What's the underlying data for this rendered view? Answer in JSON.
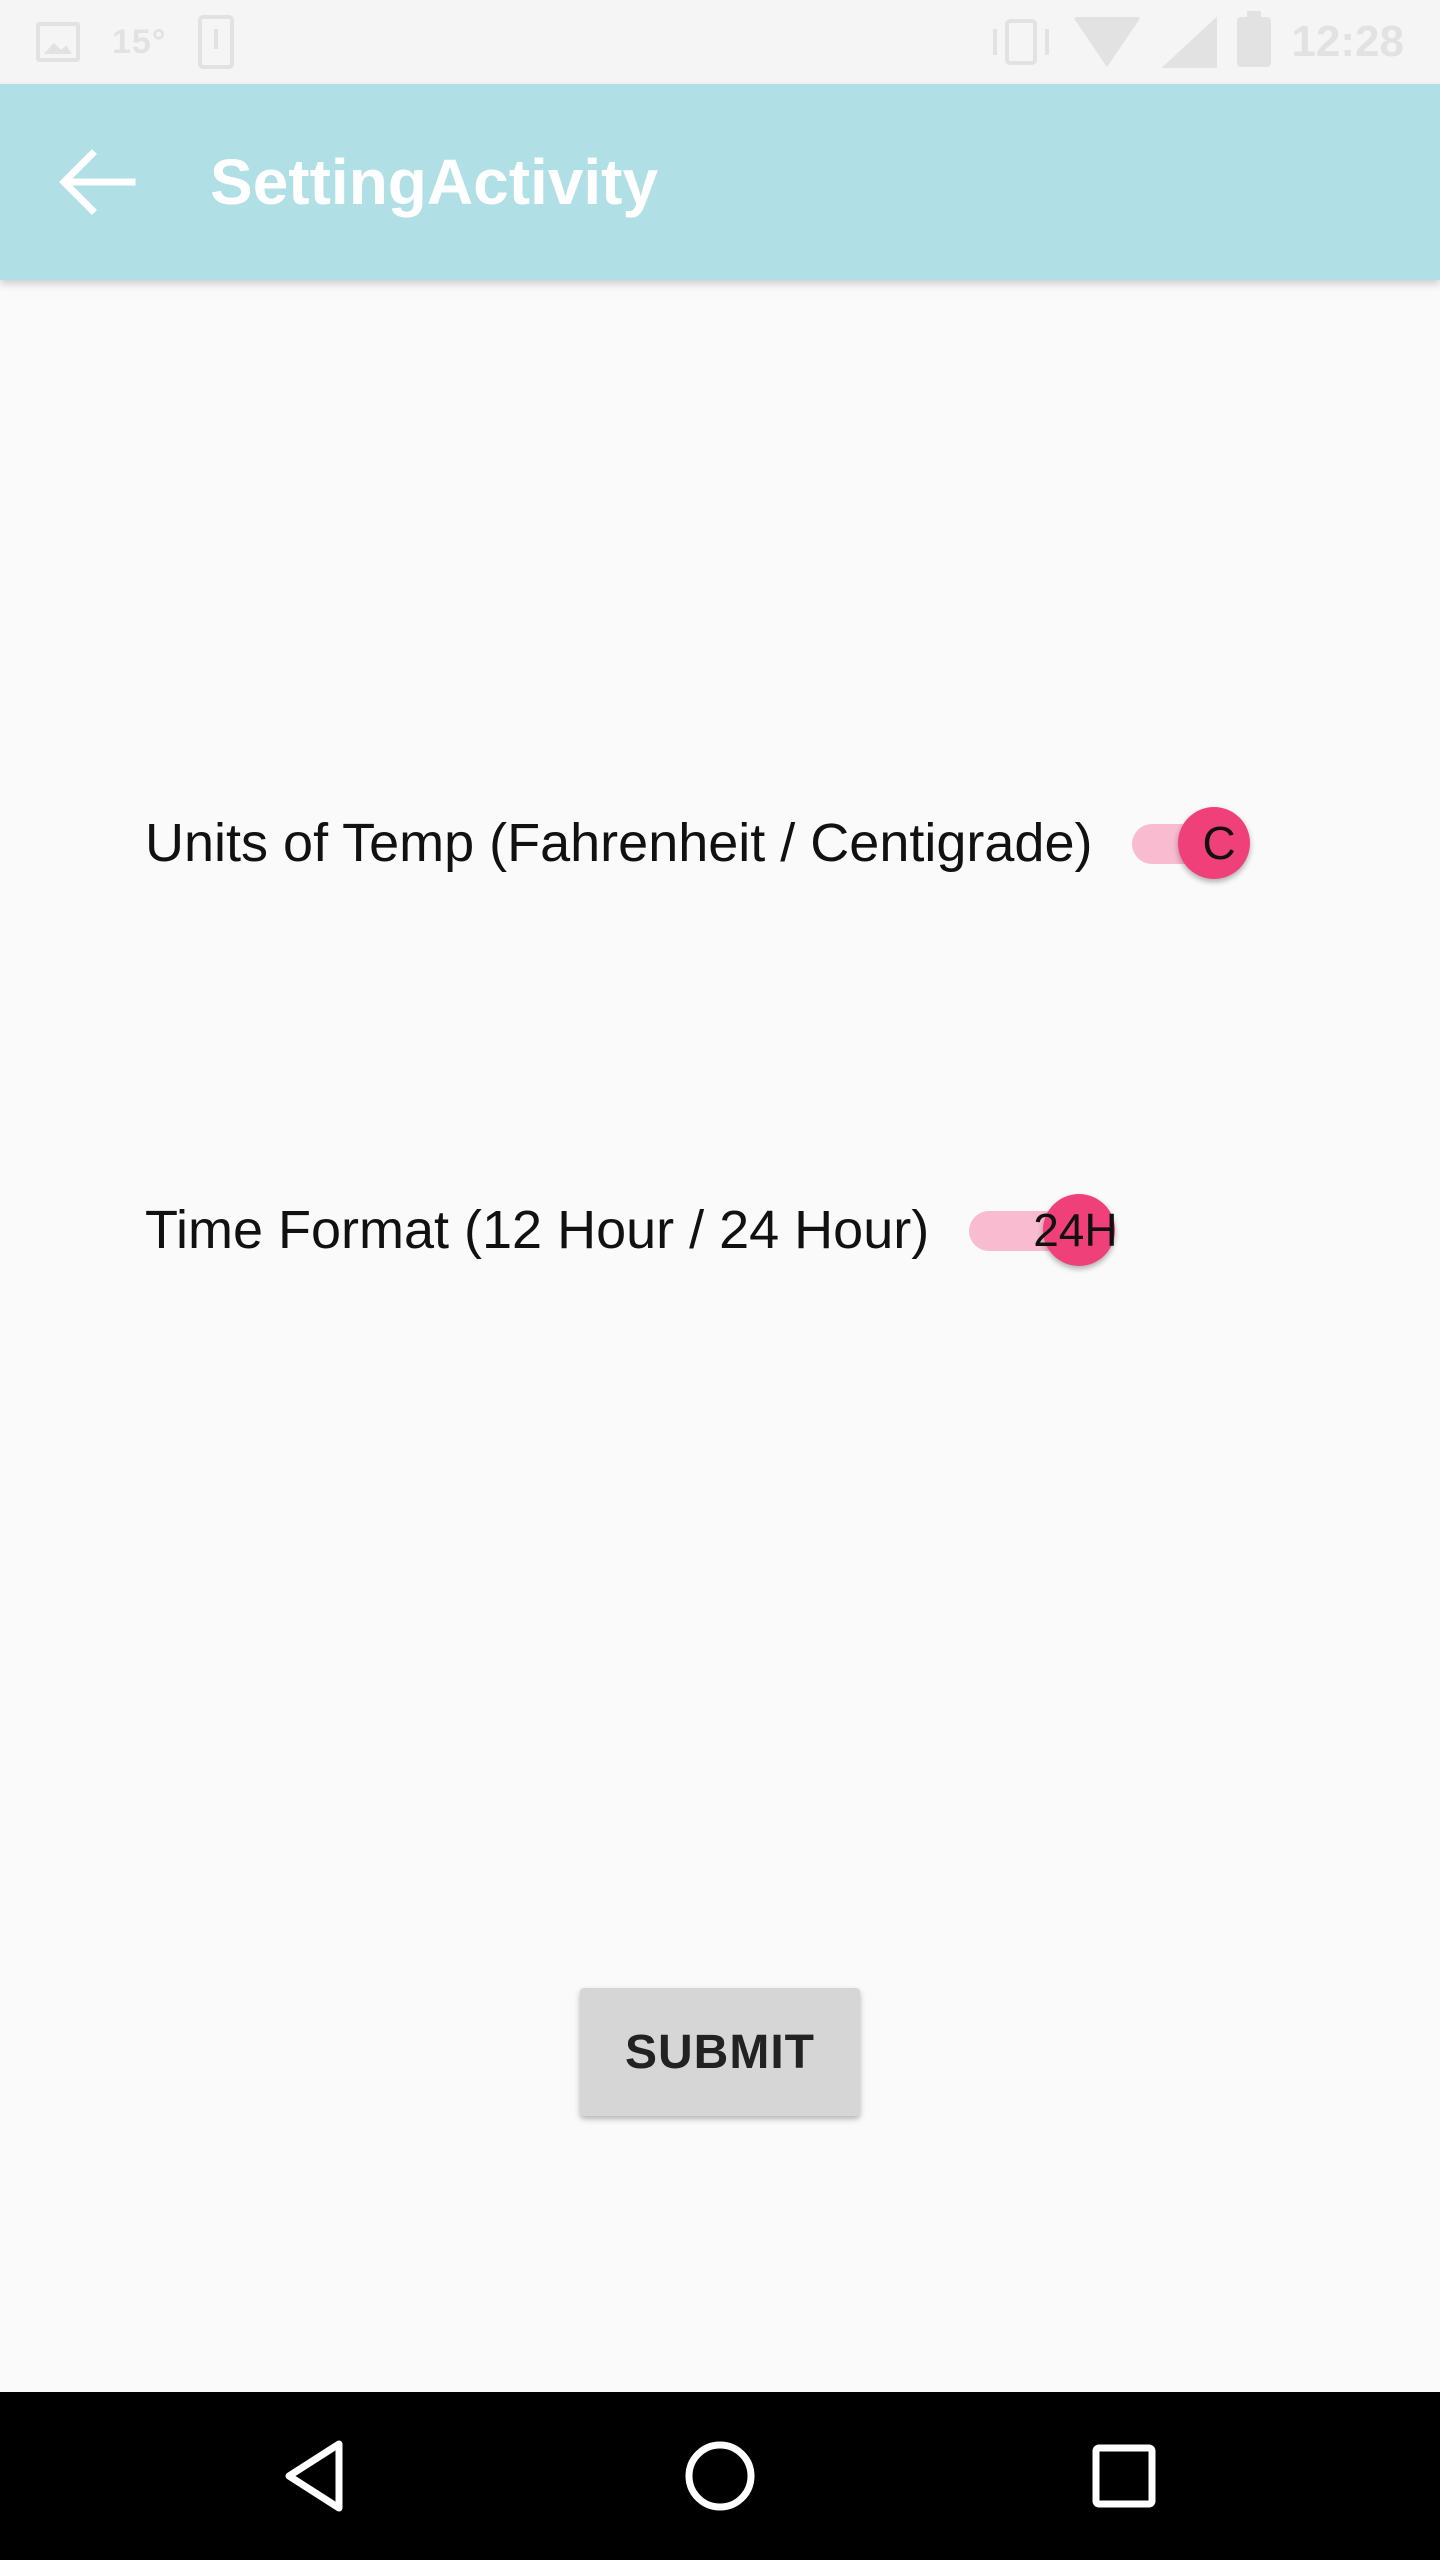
{
  "status_bar": {
    "temperature": "15°",
    "time": "12:28",
    "left_icons": [
      "image-icon",
      "download-phone-icon"
    ],
    "right_icons": [
      "vibrate-icon",
      "wifi-icon",
      "signal-icon",
      "battery-icon"
    ]
  },
  "app_bar": {
    "title": "SettingActivity",
    "back_icon": "arrow-back-icon",
    "background": "#b0dfe5"
  },
  "settings": {
    "temp_units": {
      "label": "Units of Temp (Fahrenheit / Centigrade)",
      "switch_text": "C",
      "checked": true
    },
    "time_format": {
      "label": "Time Format (12 Hour / 24 Hour)",
      "switch_text": "24H",
      "checked": true
    }
  },
  "submit": {
    "label": "SUBMIT"
  },
  "nav_bar": {
    "icons": [
      "back-triangle-icon",
      "home-circle-icon",
      "recents-square-icon"
    ]
  },
  "colors": {
    "accent": "#f0407a",
    "accent_track": "#f8bbd0",
    "background": "#fafafa",
    "button": "#d6d6d6"
  }
}
